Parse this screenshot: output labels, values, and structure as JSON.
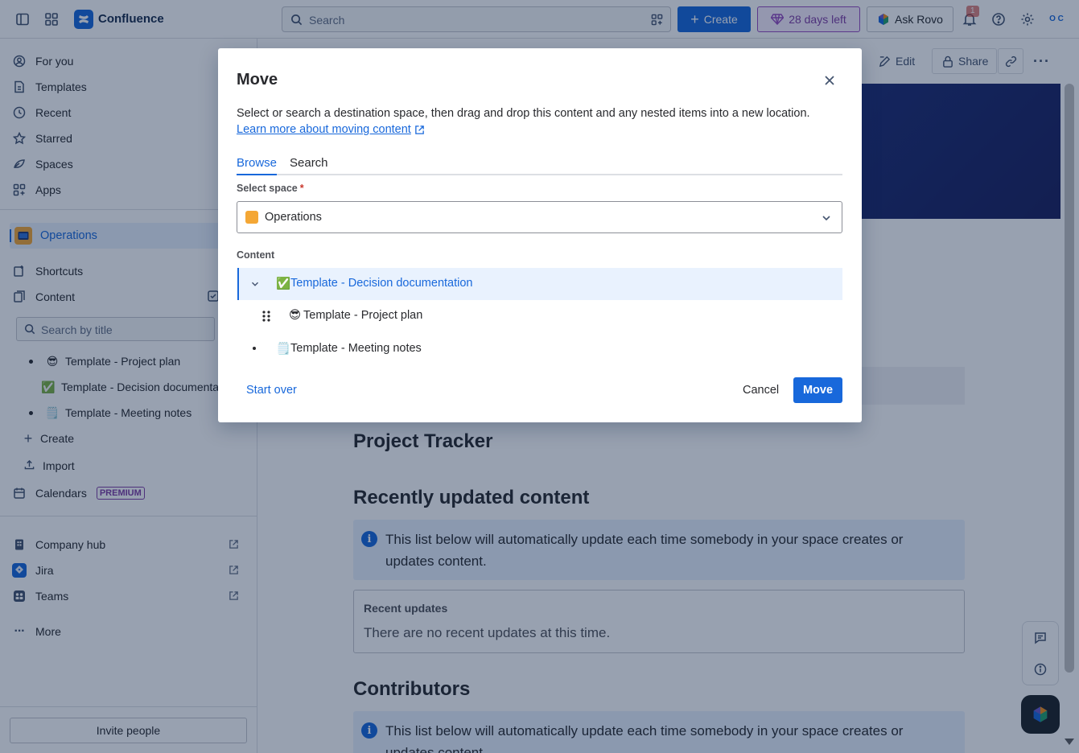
{
  "topbar": {
    "brand": "Confluence",
    "search_placeholder": "Search",
    "create_label": "Create",
    "trial_label": "28 days left",
    "rovo_label": "Ask Rovo",
    "notification_count": "1",
    "avatar_initials": "O C"
  },
  "sidebar": {
    "nav": [
      {
        "label": "For you",
        "icon": "user-circle-icon"
      },
      {
        "label": "Templates",
        "icon": "templates-icon"
      },
      {
        "label": "Recent",
        "icon": "clock-icon"
      },
      {
        "label": "Starred",
        "icon": "star-icon"
      },
      {
        "label": "Spaces",
        "icon": "spaces-icon"
      },
      {
        "label": "Apps",
        "icon": "apps-icon"
      }
    ],
    "active_space": "Operations",
    "shortcuts_label": "Shortcuts",
    "content_label": "Content",
    "search_placeholder": "Search by title",
    "tree": [
      {
        "emoji": "😎",
        "label": "Template - Project plan"
      },
      {
        "emoji": "✅",
        "label": "Template - Decision documentation"
      },
      {
        "emoji": "🗒️",
        "label": "Template - Meeting notes"
      }
    ],
    "create_label": "Create",
    "import_label": "Import",
    "calendars_label": "Calendars",
    "premium_badge": "PREMIUM",
    "apps": [
      {
        "label": "Company hub",
        "icon": "building-icon"
      },
      {
        "label": "Jira",
        "icon": "jira-icon"
      },
      {
        "label": "Teams",
        "icon": "teams-icon"
      }
    ],
    "more_label": "More",
    "invite_label": "Invite people"
  },
  "page": {
    "edit_label": "Edit",
    "share_label": "Share",
    "heading_tracker": "Project Tracker",
    "heading_recent": "Recently updated content",
    "info_text_recent": "This list below will automatically update each time somebody in your space creates or updates content.",
    "recent_updates_title": "Recent updates",
    "recent_updates_empty": "There are no recent updates at this time.",
    "heading_contributors": "Contributors",
    "info_text_contributors": "This list below will automatically update each time somebody in your space creates or updates content."
  },
  "modal": {
    "title": "Move",
    "description": "Select or search a destination space, then drag and drop this content and any nested items into a new location.",
    "learn_more": "Learn more about moving content",
    "tabs": [
      "Browse",
      "Search"
    ],
    "select_space_label": "Select space",
    "required_marker": "*",
    "selected_space": "Operations",
    "content_label": "Content",
    "tree": [
      {
        "emoji": "✅",
        "label": "Template - Decision documentation"
      },
      {
        "emoji": "😎",
        "label": "Template - Project plan"
      },
      {
        "emoji": "🗒️",
        "label": "Template - Meeting notes"
      }
    ],
    "start_over_label": "Start over",
    "cancel_label": "Cancel",
    "move_label": "Move"
  },
  "colors": {
    "brand_blue": "#1868db",
    "trial_purple": "#803fa5",
    "overlay": "rgba(9,30,66,0.42)"
  }
}
